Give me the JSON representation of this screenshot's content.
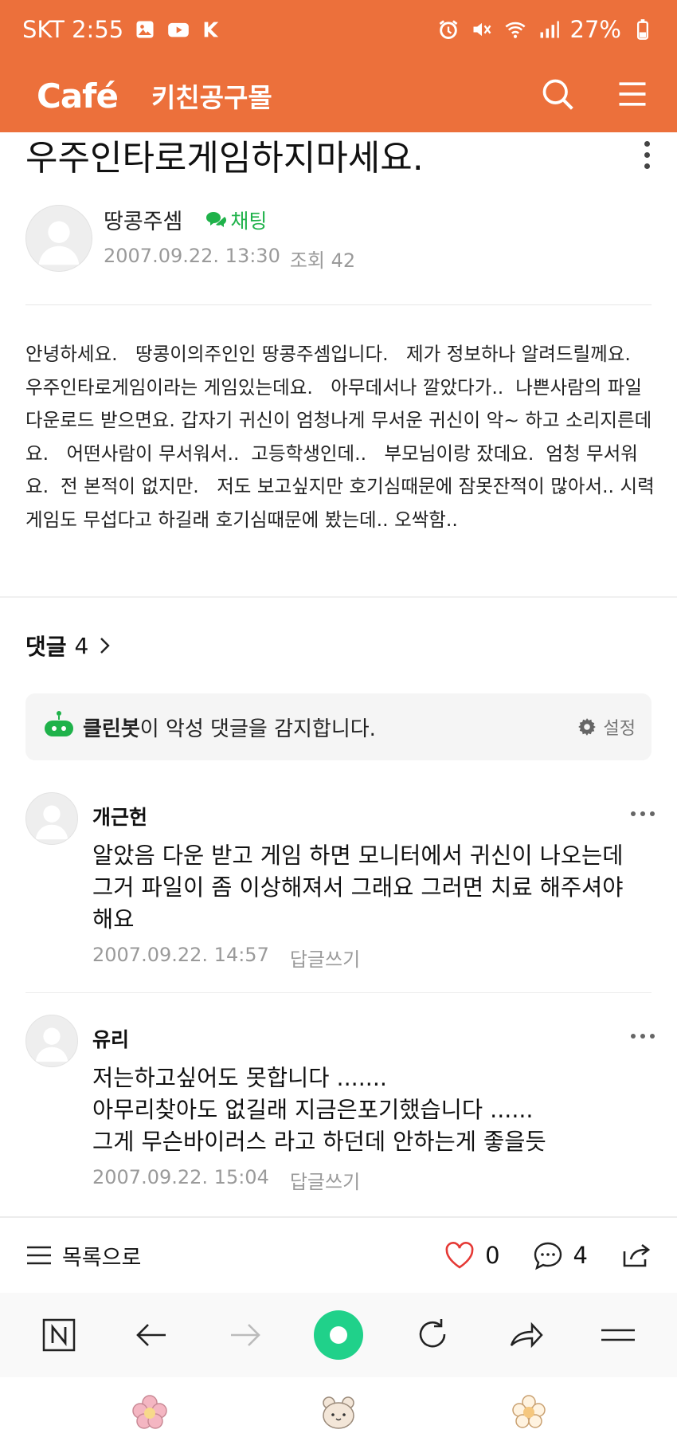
{
  "status": {
    "carrier_time": "SKT 2:55",
    "battery": "27%",
    "icons": [
      "gallery-icon",
      "youtube-icon",
      "app-icon",
      "alarm-icon",
      "mute-icon",
      "wifi-icon",
      "signal-icon",
      "battery-icon"
    ]
  },
  "header": {
    "logo": "Café",
    "cafe_name": "키친공구몰",
    "icons": [
      "search-icon",
      "menu-icon"
    ]
  },
  "post": {
    "title": "우주인타로게임하지마세요.",
    "author": "땅콩주셈",
    "chat_label": "채팅",
    "date": "2007.09.22. 13:30",
    "views": "조회 42",
    "body": "안녕하세요.   땅콩이의주인인 땅콩주셈입니다.   제가 정보하나 알려드릴께요.     우주인타로게임이라는 게임있는데요.   아무데서나 깔았다가..  나쁜사람의 파일 다운로드 받으면요. 갑자기 귀신이 엄청나게 무서운 귀신이 악~ 하고 소리지른데요.   어떤사람이 무서워서..  고등학생인데..   부모님이랑 잤데요.  엄청 무서워요.  전 본적이 없지만.   저도 보고싶지만 호기심때문에 잠못잔적이 많아서.. 시력게임도 무섭다고 하길래 호기심때문에 봤는데.. 오싹함.."
  },
  "comments_section": {
    "label": "댓글",
    "count": "4",
    "cleanbot_name": "클린봇",
    "cleanbot_text": "이 악성 댓글을 감지합니다.",
    "settings_label": "설정"
  },
  "comments": [
    {
      "author": "개근헌",
      "text": "알았음 다운 받고 게임 하면 모니터에서 귀신이 나오는데 그거 파일이 좀 이상해져서 그래요 그러면 치료 해주셔야 해요",
      "date": "2007.09.22. 14:57",
      "reply": "답글쓰기"
    },
    {
      "author": "유리",
      "text": "저는하고싶어도 못합니다 .......\n아무리찾아도 없길래 지금은포기했습니다 ......\n그게 무슨바이러스 라고 하던데 안하는게 좋을듯",
      "date": "2007.09.22. 15:04",
      "reply": "답글쓰기"
    }
  ],
  "action_bar": {
    "list_label": "목록으로",
    "likes": "0",
    "comment_count": "4"
  },
  "colors": {
    "brand": "#ec703b",
    "chat_green": "#1fb24a",
    "heart_red": "#e53935",
    "browser_green": "#20d18a"
  }
}
